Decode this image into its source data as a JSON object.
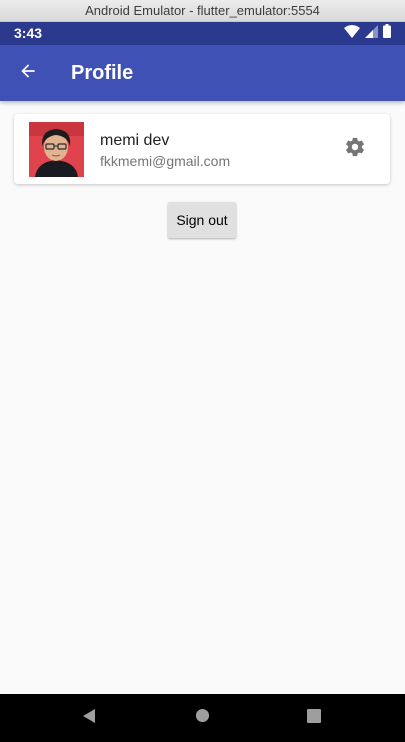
{
  "window": {
    "title": "Android Emulator - flutter_emulator:5554"
  },
  "status_bar": {
    "time": "3:43",
    "icons": [
      "wifi-icon",
      "signal-icon",
      "battery-icon"
    ]
  },
  "app_bar": {
    "title": "Profile",
    "back_icon": "arrow-back-icon",
    "background": "#3f51b5"
  },
  "profile": {
    "name": "memi dev",
    "email": "fkkmemi@gmail.com",
    "avatar": "user-photo",
    "settings_icon": "gear-icon"
  },
  "actions": {
    "sign_out_label": "Sign out"
  },
  "nav_bar": {
    "buttons": [
      "back-triangle-icon",
      "home-circle-icon",
      "recents-square-icon"
    ]
  }
}
